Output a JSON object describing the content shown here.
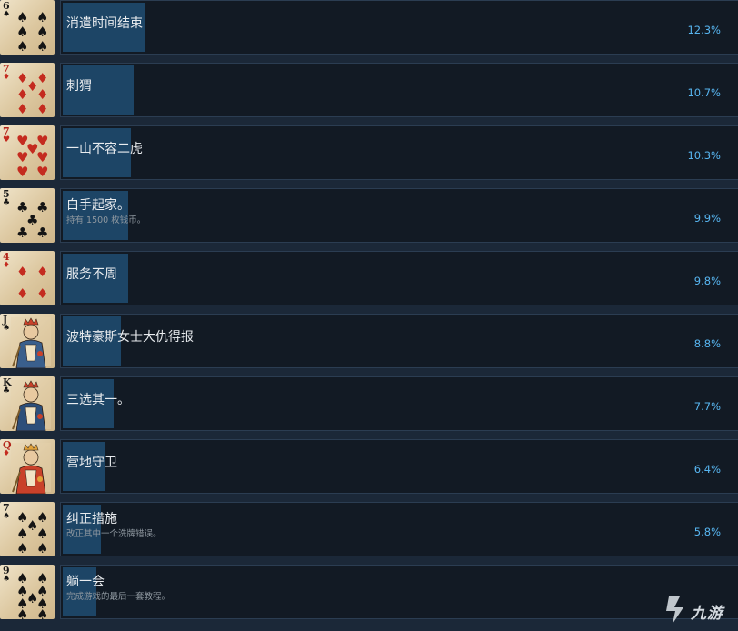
{
  "achievements": [
    {
      "title": "消遣时间结束",
      "desc": "",
      "percent": "12.3%",
      "fill": 0.123,
      "card": {
        "rank": "6",
        "suit": "spade",
        "suit_glyph": "♠",
        "color": "black",
        "face": false,
        "count": 6
      }
    },
    {
      "title": "刺猬",
      "desc": "",
      "percent": "10.7%",
      "fill": 0.107,
      "card": {
        "rank": "7",
        "suit": "diamond",
        "suit_glyph": "♦",
        "color": "red",
        "face": false,
        "count": 7
      }
    },
    {
      "title": "一山不容二虎",
      "desc": "",
      "percent": "10.3%",
      "fill": 0.103,
      "card": {
        "rank": "7",
        "suit": "heart",
        "suit_glyph": "♥",
        "color": "red",
        "face": false,
        "count": 7
      }
    },
    {
      "title": "白手起家。",
      "desc": "持有 1500 枚钱币。",
      "percent": "9.9%",
      "fill": 0.099,
      "card": {
        "rank": "5",
        "suit": "club",
        "suit_glyph": "♣",
        "color": "black",
        "face": false,
        "count": 5
      }
    },
    {
      "title": "服务不周",
      "desc": "",
      "percent": "9.8%",
      "fill": 0.098,
      "card": {
        "rank": "4",
        "suit": "diamond",
        "suit_glyph": "♦",
        "color": "red",
        "face": false,
        "count": 4
      }
    },
    {
      "title": "波特豪斯女士大仇得报",
      "desc": "",
      "percent": "8.8%",
      "fill": 0.088,
      "card": {
        "rank": "J",
        "suit": "spade",
        "suit_glyph": "♠",
        "color": "black",
        "face": true,
        "count": 0
      }
    },
    {
      "title": "三选其一。",
      "desc": "",
      "percent": "7.7%",
      "fill": 0.077,
      "card": {
        "rank": "K",
        "suit": "club",
        "suit_glyph": "♣",
        "color": "black",
        "face": true,
        "count": 0
      }
    },
    {
      "title": "营地守卫",
      "desc": "",
      "percent": "6.4%",
      "fill": 0.064,
      "card": {
        "rank": "Q",
        "suit": "diamond",
        "suit_glyph": "♦",
        "color": "red",
        "face": true,
        "count": 0
      }
    },
    {
      "title": "纠正措施",
      "desc": "改正其中一个洗牌错误。",
      "percent": "5.8%",
      "fill": 0.058,
      "card": {
        "rank": "7",
        "suit": "spade",
        "suit_glyph": "♠",
        "color": "black",
        "face": false,
        "count": 7
      }
    },
    {
      "title": "躺一会",
      "desc": "完成游戏的最后一套教程。",
      "percent": "",
      "fill": 0.05,
      "card": {
        "rank": "9",
        "suit": "spade",
        "suit_glyph": "♠",
        "color": "black",
        "face": false,
        "count": 9
      }
    }
  ],
  "watermark": {
    "text": "九游"
  },
  "colors": {
    "background": "#1b2838",
    "panel": "#121a24",
    "bar": "#1d4566",
    "percent": "#57b5f0",
    "title": "#e9ecef",
    "desc": "#8f98a0"
  }
}
